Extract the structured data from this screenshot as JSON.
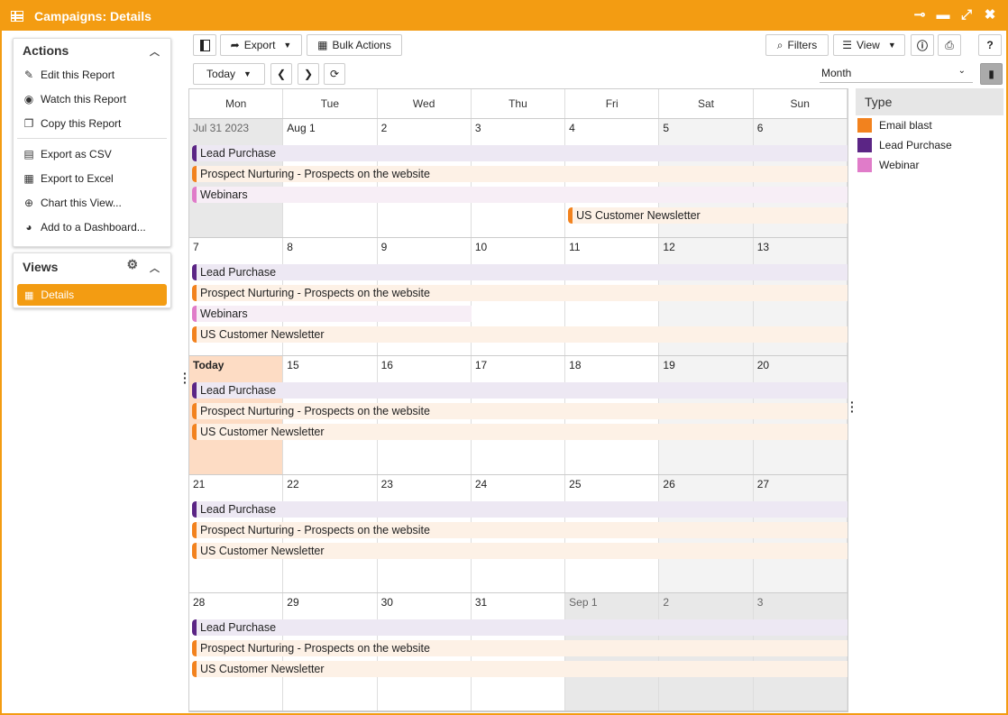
{
  "window": {
    "title": "Campaigns: Details"
  },
  "sidebar": {
    "actions_title": "Actions",
    "actions": [
      {
        "label": "Edit this Report",
        "icon": "pencil-icon",
        "glyph": "✎"
      },
      {
        "label": "Watch this Report",
        "icon": "eye-icon",
        "glyph": "◉"
      },
      {
        "label": "Copy this Report",
        "icon": "copy-icon",
        "glyph": "❐"
      },
      {
        "label": "Export as CSV",
        "icon": "csv-file-icon",
        "glyph": "▤"
      },
      {
        "label": "Export to Excel",
        "icon": "excel-file-icon",
        "glyph": "▦"
      },
      {
        "label": "Chart this View...",
        "icon": "plus-circle-icon",
        "glyph": "⊕"
      },
      {
        "label": "Add to a Dashboard...",
        "icon": "dashboard-icon",
        "glyph": "◕"
      }
    ],
    "views_title": "Views",
    "views": [
      {
        "label": "Details",
        "icon": "table-icon"
      }
    ]
  },
  "toolbar": {
    "export_label": "Export",
    "bulk_label": "Bulk Actions",
    "filters_label": "Filters",
    "view_label": "View",
    "today_label": "Today",
    "range_value": "Month"
  },
  "calendar": {
    "weekdays": [
      "Mon",
      "Tue",
      "Wed",
      "Thu",
      "Fri",
      "Sat",
      "Sun"
    ],
    "weeks": [
      {
        "days": [
          "Jul 31 2023",
          "Aug 1",
          "2",
          "3",
          "4",
          "5",
          "6"
        ],
        "events": [
          {
            "label": "Lead Purchase",
            "type": "lead",
            "start": 0,
            "span": 7,
            "row": 0
          },
          {
            "label": "Prospect Nurturing - Prospects on the website",
            "type": "email",
            "start": 0,
            "span": 7,
            "row": 1
          },
          {
            "label": "Webinars",
            "type": "web",
            "start": 0,
            "span": 7,
            "row": 2
          },
          {
            "label": "US Customer Newsletter",
            "type": "email",
            "start": 4,
            "span": 3,
            "row": 3
          }
        ]
      },
      {
        "days": [
          "7",
          "8",
          "9",
          "10",
          "11",
          "12",
          "13"
        ],
        "events": [
          {
            "label": "Lead Purchase",
            "type": "lead",
            "start": 0,
            "span": 7,
            "row": 0
          },
          {
            "label": "Prospect Nurturing - Prospects on the website",
            "type": "email",
            "start": 0,
            "span": 7,
            "row": 1
          },
          {
            "label": "Webinars",
            "type": "web",
            "start": 0,
            "span": 3,
            "row": 2
          },
          {
            "label": "US Customer Newsletter",
            "type": "email",
            "start": 0,
            "span": 7,
            "row": 3
          }
        ]
      },
      {
        "days": [
          "Today",
          "15",
          "16",
          "17",
          "18",
          "19",
          "20"
        ],
        "events": [
          {
            "label": "Lead Purchase",
            "type": "lead",
            "start": 0,
            "span": 7,
            "row": 0
          },
          {
            "label": "Prospect Nurturing - Prospects on the website",
            "type": "email",
            "start": 0,
            "span": 7,
            "row": 1
          },
          {
            "label": "US Customer Newsletter",
            "type": "email",
            "start": 0,
            "span": 7,
            "row": 2
          }
        ]
      },
      {
        "days": [
          "21",
          "22",
          "23",
          "24",
          "25",
          "26",
          "27"
        ],
        "events": [
          {
            "label": "Lead Purchase",
            "type": "lead",
            "start": 0,
            "span": 7,
            "row": 0
          },
          {
            "label": "Prospect Nurturing - Prospects on the website",
            "type": "email",
            "start": 0,
            "span": 7,
            "row": 1
          },
          {
            "label": "US Customer Newsletter",
            "type": "email",
            "start": 0,
            "span": 7,
            "row": 2
          }
        ]
      },
      {
        "days": [
          "28",
          "29",
          "30",
          "31",
          "Sep 1",
          "2",
          "3"
        ],
        "events": [
          {
            "label": "Lead Purchase",
            "type": "lead",
            "start": 0,
            "span": 7,
            "row": 0
          },
          {
            "label": "Prospect Nurturing - Prospects on the website",
            "type": "email",
            "start": 0,
            "span": 7,
            "row": 1
          },
          {
            "label": "US Customer Newsletter",
            "type": "email",
            "start": 0,
            "span": 7,
            "row": 2
          }
        ]
      }
    ]
  },
  "legend": {
    "title": "Type",
    "items": [
      {
        "label": "Email blast",
        "color": "#f2821e"
      },
      {
        "label": "Lead Purchase",
        "color": "#5b2585"
      },
      {
        "label": "Webinar",
        "color": "#e07cc9"
      }
    ]
  },
  "colors": {
    "accent": "#f39c12"
  }
}
